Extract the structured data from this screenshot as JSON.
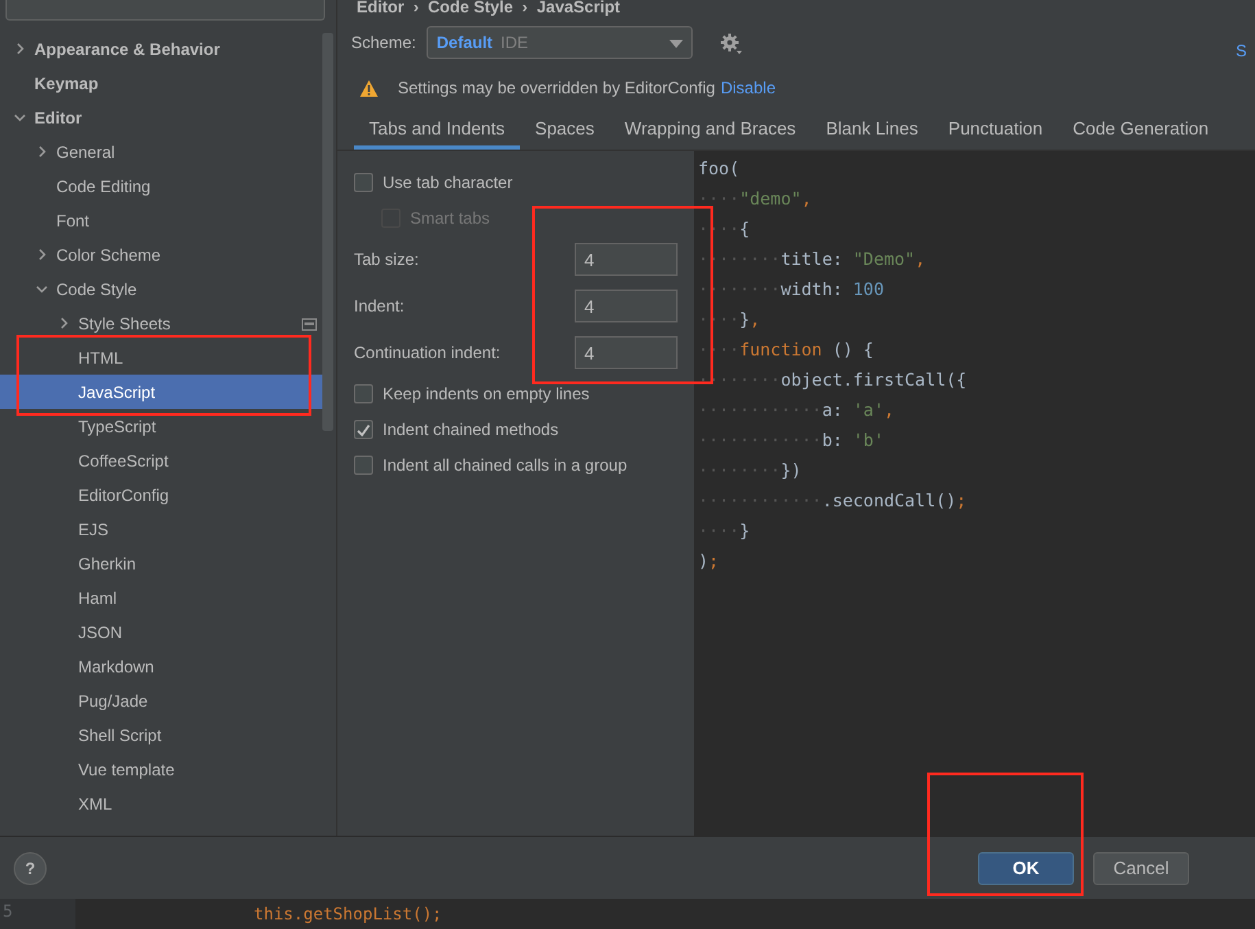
{
  "breadcrumb": "Editor  ›  Code Style  ›  JavaScript",
  "sidebar": {
    "items": [
      {
        "label": "Appearance & Behavior",
        "kind": "folder",
        "bold": true,
        "expanded": false,
        "selected": false
      },
      {
        "label": "Keymap",
        "kind": "leaf",
        "bold": true,
        "selected": false
      },
      {
        "label": "Editor",
        "kind": "folder",
        "bold": true,
        "expanded": true,
        "selected": false,
        "children": [
          {
            "label": "General",
            "kind": "folder",
            "expanded": false,
            "selected": false
          },
          {
            "label": "Code Editing",
            "kind": "leaf",
            "selected": false
          },
          {
            "label": "Font",
            "kind": "leaf",
            "selected": false
          },
          {
            "label": "Color Scheme",
            "kind": "folder",
            "expanded": false,
            "selected": false
          },
          {
            "label": "Code Style",
            "kind": "folder",
            "expanded": true,
            "selected": false,
            "children": [
              {
                "label": "Style Sheets",
                "kind": "folder",
                "expanded": false,
                "selected": false,
                "scheme_icon": true
              },
              {
                "label": "HTML",
                "kind": "leaf",
                "selected": false,
                "annotated": true
              },
              {
                "label": "JavaScript",
                "kind": "leaf",
                "selected": true,
                "annotated": true
              },
              {
                "label": "TypeScript",
                "kind": "leaf",
                "selected": false
              },
              {
                "label": "CoffeeScript",
                "kind": "leaf",
                "selected": false
              },
              {
                "label": "EditorConfig",
                "kind": "leaf",
                "selected": false
              },
              {
                "label": "EJS",
                "kind": "leaf",
                "selected": false
              },
              {
                "label": "Gherkin",
                "kind": "leaf",
                "selected": false
              },
              {
                "label": "Haml",
                "kind": "leaf",
                "selected": false
              },
              {
                "label": "JSON",
                "kind": "leaf",
                "selected": false
              },
              {
                "label": "Markdown",
                "kind": "leaf",
                "selected": false
              },
              {
                "label": "Pug/Jade",
                "kind": "leaf",
                "selected": false
              },
              {
                "label": "Shell Script",
                "kind": "leaf",
                "selected": false
              },
              {
                "label": "Vue template",
                "kind": "leaf",
                "selected": false
              },
              {
                "label": "XML",
                "kind": "leaf",
                "selected": false
              }
            ]
          }
        ]
      }
    ]
  },
  "scheme": {
    "label": "Scheme:",
    "name": "Default",
    "scope": "IDE"
  },
  "right_link": "S",
  "warning": {
    "text": "Settings may be overridden by EditorConfig",
    "link": "Disable"
  },
  "tabs": [
    {
      "label": "Tabs and Indents",
      "selected": true
    },
    {
      "label": "Spaces",
      "selected": false
    },
    {
      "label": "Wrapping and Braces",
      "selected": false
    },
    {
      "label": "Blank Lines",
      "selected": false
    },
    {
      "label": "Punctuation",
      "selected": false
    },
    {
      "label": "Code Generation",
      "selected": false
    }
  ],
  "options": [
    {
      "kind": "checkbox",
      "label": "Use tab character",
      "checked": false,
      "disabled": false,
      "nested": false
    },
    {
      "kind": "checkbox",
      "label": "Smart tabs",
      "checked": false,
      "disabled": true,
      "nested": true
    },
    {
      "kind": "field",
      "label": "Tab size:",
      "value": "4",
      "annotated": true
    },
    {
      "kind": "field",
      "label": "Indent:",
      "value": "4",
      "annotated": true
    },
    {
      "kind": "field",
      "label": "Continuation indent:",
      "value": "4",
      "annotated": true
    },
    {
      "kind": "checkbox",
      "label": "Keep indents on empty lines",
      "checked": false,
      "disabled": false,
      "nested": false
    },
    {
      "kind": "checkbox",
      "label": "Indent chained methods",
      "checked": true,
      "disabled": false,
      "nested": false
    },
    {
      "kind": "checkbox",
      "label": "Indent all chained calls in a group",
      "checked": false,
      "disabled": false,
      "nested": false
    }
  ],
  "code_preview": [
    [
      {
        "kind": "plain",
        "text": "foo("
      }
    ],
    [
      {
        "kind": "ws",
        "text": "····"
      },
      {
        "kind": "string",
        "text": "\"demo\""
      },
      {
        "kind": "keyword",
        "text": ","
      }
    ],
    [
      {
        "kind": "ws",
        "text": "····"
      },
      {
        "kind": "plain",
        "text": "{"
      }
    ],
    [
      {
        "kind": "ws",
        "text": "········"
      },
      {
        "kind": "plain",
        "text": "title: "
      },
      {
        "kind": "string",
        "text": "\"Demo\""
      },
      {
        "kind": "keyword",
        "text": ","
      }
    ],
    [
      {
        "kind": "ws",
        "text": "········"
      },
      {
        "kind": "plain",
        "text": "width: "
      },
      {
        "kind": "number",
        "text": "100"
      }
    ],
    [
      {
        "kind": "ws",
        "text": "····"
      },
      {
        "kind": "plain",
        "text": "}"
      },
      {
        "kind": "keyword",
        "text": ","
      }
    ],
    [
      {
        "kind": "ws",
        "text": "····"
      },
      {
        "kind": "keyword",
        "text": "function"
      },
      {
        "kind": "plain",
        "text": " () {"
      }
    ],
    [
      {
        "kind": "ws",
        "text": "········"
      },
      {
        "kind": "plain",
        "text": "object.firstCall({"
      }
    ],
    [
      {
        "kind": "ws",
        "text": "············"
      },
      {
        "kind": "plain",
        "text": "a: "
      },
      {
        "kind": "string",
        "text": "'a'"
      },
      {
        "kind": "keyword",
        "text": ","
      }
    ],
    [
      {
        "kind": "ws",
        "text": "············"
      },
      {
        "kind": "plain",
        "text": "b: "
      },
      {
        "kind": "string",
        "text": "'b'"
      }
    ],
    [
      {
        "kind": "ws",
        "text": "········"
      },
      {
        "kind": "plain",
        "text": "})"
      }
    ],
    [
      {
        "kind": "ws",
        "text": "············"
      },
      {
        "kind": "plain",
        "text": ".secondCall()"
      },
      {
        "kind": "keyword",
        "text": ";"
      }
    ],
    [
      {
        "kind": "ws",
        "text": "····"
      },
      {
        "kind": "plain",
        "text": "}"
      }
    ],
    [
      {
        "kind": "plain",
        "text": ")"
      },
      {
        "kind": "keyword",
        "text": ";"
      }
    ]
  ],
  "help_label": "?",
  "buttons": [
    {
      "label": "OK",
      "default": true,
      "annotated": true
    },
    {
      "label": "Cancel",
      "default": false
    }
  ],
  "editor_behind": {
    "line_number": "5",
    "code": "this.getShopList();"
  }
}
